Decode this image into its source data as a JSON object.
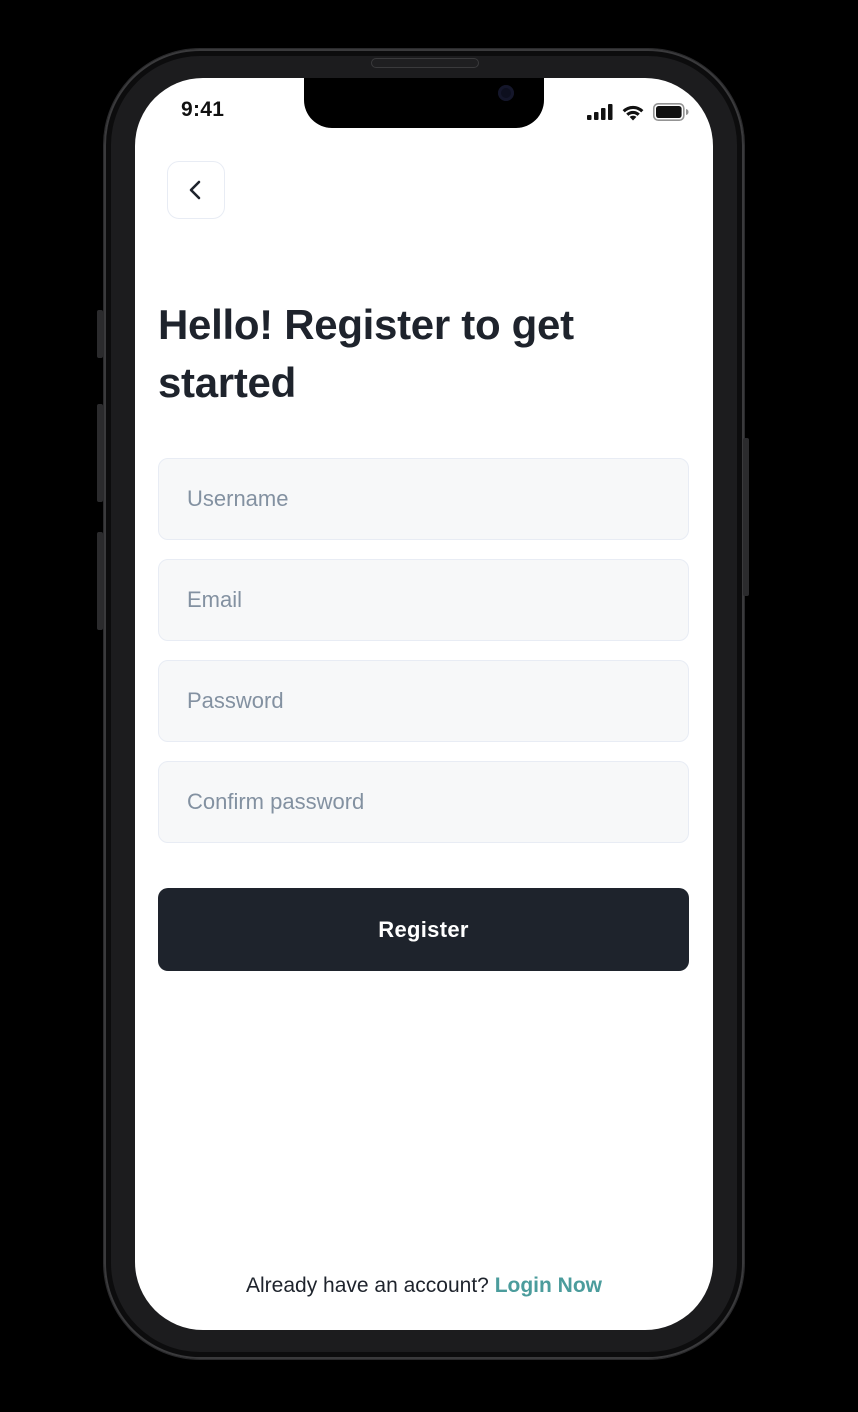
{
  "status_bar": {
    "time": "9:41",
    "icons": [
      "cellular-signal-icon",
      "wifi-icon",
      "battery-icon"
    ]
  },
  "header": {
    "back_icon": "chevron-left-icon"
  },
  "main": {
    "title": "Hello! Register to get started",
    "fields": {
      "username": {
        "placeholder": "Username",
        "value": ""
      },
      "email": {
        "placeholder": "Email",
        "value": ""
      },
      "password": {
        "placeholder": "Password",
        "value": ""
      },
      "confirm_password": {
        "placeholder": "Confirm password",
        "value": ""
      }
    },
    "register_label": "Register"
  },
  "footer": {
    "prompt": "Already have an account?",
    "login_label": "Login Now"
  },
  "colors": {
    "background": "#000000",
    "screen": "#ffffff",
    "primary_button": "#1e232c",
    "field_background": "#f7f8f9",
    "field_border": "#e8ecf4",
    "placeholder": "#8391a1",
    "link": "#4b9c9c"
  }
}
